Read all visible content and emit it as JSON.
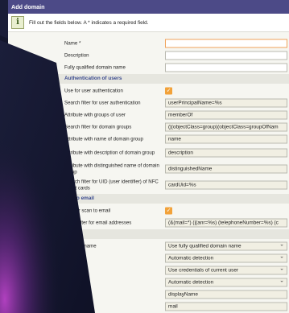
{
  "dialog": {
    "title": "Add domain",
    "info": "Fill out the fields below. A * indicates a required field."
  },
  "fields_top": [
    {
      "label": "Name *",
      "value": ""
    },
    {
      "label": "Description",
      "value": ""
    },
    {
      "label": "Fully qualified domain name",
      "value": ""
    }
  ],
  "sections": {
    "auth": "Authentication of users",
    "scan": "can to email",
    "adv": "vanced"
  },
  "auth_rows": {
    "use_auth": "Use for user authentication",
    "search_filter_auth": {
      "label": "Search filter for user authentication",
      "value": "userPrincipalName=%s"
    },
    "attr_groups": {
      "label": "Attribute with groups of user",
      "value": "memberOf"
    },
    "search_filter_groups": {
      "label": "Search filter for domain groups",
      "value": "(|(objectClass=group)(objectClass=groupOfNam"
    },
    "attr_name": {
      "label": "Attribute with name of domain group",
      "value": "name"
    },
    "attr_desc": {
      "label": "Attribute with description of domain group",
      "value": "description"
    },
    "attr_dn": {
      "label": "Attribute with distinguished name of domain group",
      "value": "distinguishedName"
    },
    "search_uid": {
      "label": "Search filter for UID (user identifier) of NFC smart cards",
      "value": "cardUid=%s"
    }
  },
  "scan_rows": {
    "use_scan": "Use for scan to email",
    "search_email": {
      "label": "earch filter for email addresses",
      "value": "(&(mail=*) (|(anr=%s) (telephoneNumber=%s) (c"
    }
  },
  "adv_rows": [
    {
      "label": "r for username",
      "value": "Use fully qualified domain name"
    },
    {
      "label": "erver",
      "value": "Automatic detection"
    },
    {
      "label": "nection",
      "value": "Use credentials of current user"
    },
    {
      "label": "h base",
      "value": "Automatic detection"
    },
    {
      "label": "username",
      "value": "displayName"
    },
    {
      "label": "mail address",
      "value": "mail"
    }
  ],
  "colors": {
    "title_bar": "#4c4a87",
    "section_text": "#3b4b8f",
    "checkbox": "#f2a23a",
    "required_border": "#f0a35a"
  }
}
